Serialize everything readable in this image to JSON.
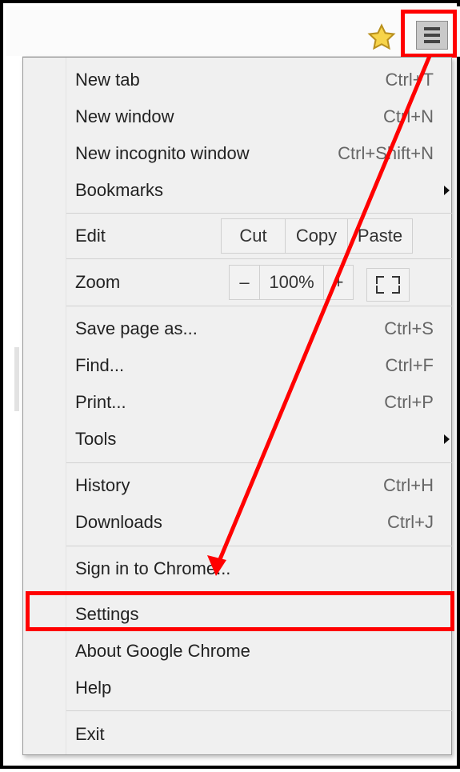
{
  "menu": {
    "items": [
      {
        "label": "New tab",
        "shortcut": "Ctrl+T"
      },
      {
        "label": "New window",
        "shortcut": "Ctrl+N"
      },
      {
        "label": "New incognito window",
        "shortcut": "Ctrl+Shift+N"
      },
      {
        "label": "Bookmarks",
        "shortcut": ""
      },
      {
        "label": "Edit",
        "shortcut": ""
      },
      {
        "label": "Zoom",
        "shortcut": ""
      },
      {
        "label": "Save page as...",
        "shortcut": "Ctrl+S"
      },
      {
        "label": "Find...",
        "shortcut": "Ctrl+F"
      },
      {
        "label": "Print...",
        "shortcut": "Ctrl+P"
      },
      {
        "label": "Tools",
        "shortcut": ""
      },
      {
        "label": "History",
        "shortcut": "Ctrl+H"
      },
      {
        "label": "Downloads",
        "shortcut": "Ctrl+J"
      },
      {
        "label": "Sign in to Chrome...",
        "shortcut": ""
      },
      {
        "label": "Settings",
        "shortcut": ""
      },
      {
        "label": "About Google Chrome",
        "shortcut": ""
      },
      {
        "label": "Help",
        "shortcut": ""
      },
      {
        "label": "Exit",
        "shortcut": ""
      }
    ],
    "edit_buttons": [
      "Cut",
      "Copy",
      "Paste"
    ],
    "zoom": {
      "minus": "–",
      "value": "100%",
      "plus": "+"
    }
  },
  "toolbar": {
    "bookmark_icon": "star-icon",
    "menu_icon": "hamburger-menu-icon"
  },
  "annotation": {
    "highlight_color": "#ff0000"
  }
}
